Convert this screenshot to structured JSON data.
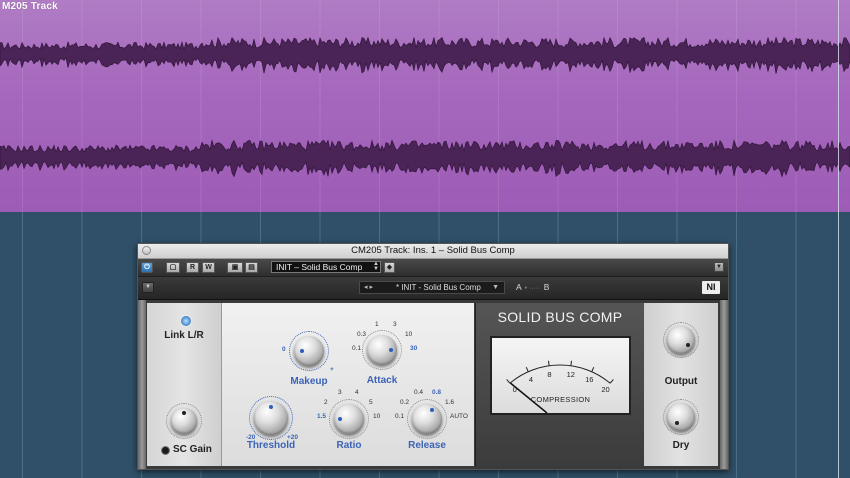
{
  "track": {
    "title": "M205 Track",
    "color": "#a567bd"
  },
  "plugin_window": {
    "title": "CM205 Track: Ins. 1 – Solid Bus Comp",
    "host_bar": {
      "buttons": [
        "",
        "R",
        "W",
        "",
        ""
      ],
      "preset_name": "INIT – Solid Bus Comp"
    },
    "plugin_header": {
      "preset_name": "* INIT - Solid Bus Comp",
      "ab_a": "A",
      "ab_b": "B",
      "logo": "NI"
    }
  },
  "sidechain": {
    "link_label": "Link L/R",
    "sc_gain_label": "SC Gain"
  },
  "controls": {
    "makeup": {
      "label": "Makeup",
      "min": "0",
      "max": "+"
    },
    "attack": {
      "label": "Attack",
      "ticks": [
        "1",
        "3",
        "0.3",
        "10",
        "0.1",
        "30"
      ]
    },
    "threshold": {
      "label": "Threshold",
      "min": "-20",
      "max": "+20"
    },
    "ratio": {
      "label": "Ratio",
      "ticks": [
        "3",
        "4",
        "2",
        "5",
        "1.5",
        "10"
      ]
    },
    "release": {
      "label": "Release",
      "ticks": [
        "0.4",
        "0.8",
        "0.2",
        "1.6",
        "0.1",
        "AUTO"
      ]
    }
  },
  "meter": {
    "title": "SOLID BUS COMP",
    "scale": [
      "0",
      "4",
      "8",
      "12",
      "16",
      "20"
    ],
    "label": "COMPRESSION",
    "value_db": 1
  },
  "output": {
    "label": "Output"
  },
  "dry": {
    "label": "Dry"
  },
  "colors": {
    "accent": "#3b63b8",
    "track": "#a567bd",
    "arrange_bg": "#2f5068"
  }
}
